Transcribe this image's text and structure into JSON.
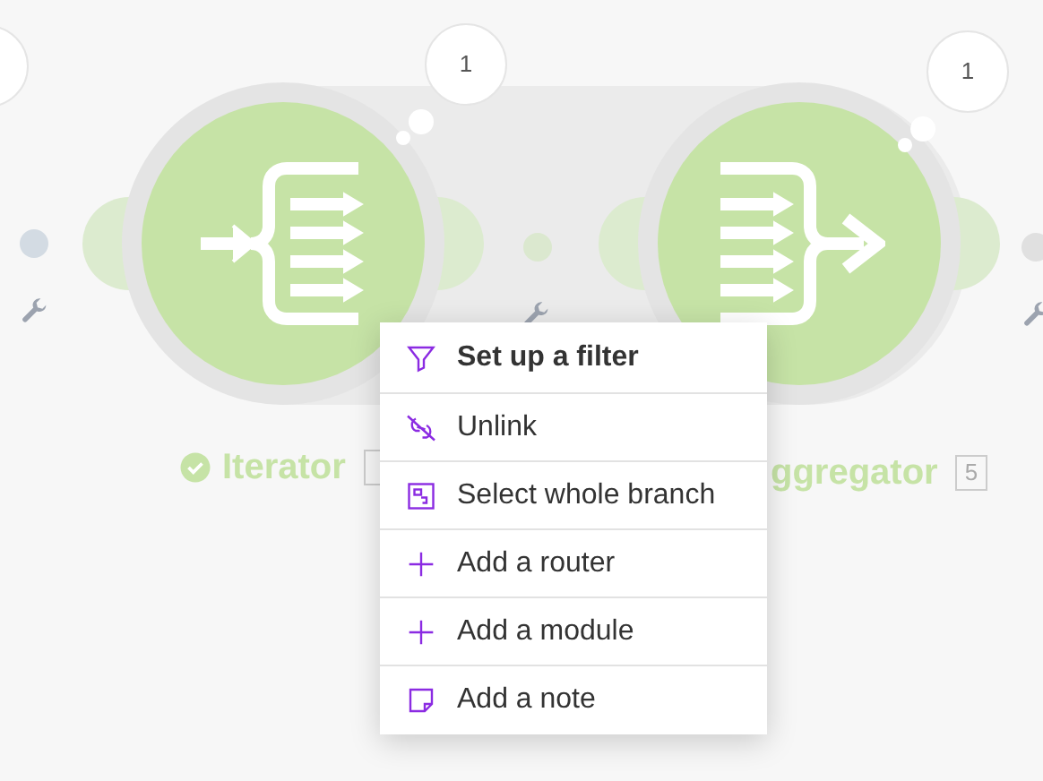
{
  "modules": [
    {
      "kind": "iterator",
      "label": "Iterator",
      "verified": true,
      "bubble": "1"
    },
    {
      "kind": "aggregator",
      "label": "ggregator",
      "badge": "5",
      "bubble": "1"
    }
  ],
  "context_menu": {
    "items": [
      {
        "kind": "filter",
        "label": "Set up a filter",
        "bold": true
      },
      {
        "kind": "unlink",
        "label": "Unlink",
        "bold": false
      },
      {
        "kind": "select",
        "label": "Select whole branch",
        "bold": false
      },
      {
        "kind": "add",
        "label": "Add a router",
        "bold": false
      },
      {
        "kind": "add",
        "label": "Add a module",
        "bold": false
      },
      {
        "kind": "note",
        "label": "Add a note",
        "bold": false
      }
    ]
  }
}
